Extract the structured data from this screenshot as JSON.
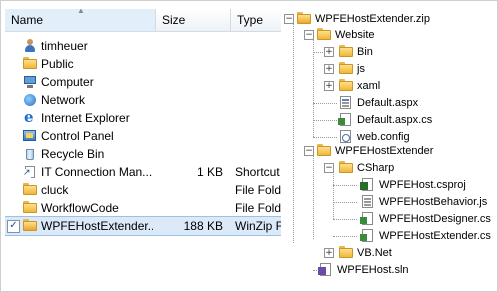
{
  "file_list": {
    "columns": {
      "name": "Name",
      "size": "Size",
      "type": "Type"
    },
    "rows": [
      {
        "name": "timheuer",
        "size": "",
        "type": "",
        "icon": "user-folder-icon",
        "checked": false
      },
      {
        "name": "Public",
        "size": "",
        "type": "",
        "icon": "folder-icon",
        "checked": false
      },
      {
        "name": "Computer",
        "size": "",
        "type": "",
        "icon": "computer-icon",
        "checked": false
      },
      {
        "name": "Network",
        "size": "",
        "type": "",
        "icon": "network-icon",
        "checked": false
      },
      {
        "name": "Internet Explorer",
        "size": "",
        "type": "",
        "icon": "internet-explorer-icon",
        "checked": false
      },
      {
        "name": "Control Panel",
        "size": "",
        "type": "",
        "icon": "control-panel-icon",
        "checked": false
      },
      {
        "name": "Recycle Bin",
        "size": "",
        "type": "",
        "icon": "recycle-bin-icon",
        "checked": false
      },
      {
        "name": "IT Connection Man...",
        "size": "1 KB",
        "type": "Shortcut",
        "icon": "shortcut-icon",
        "checked": false
      },
      {
        "name": "cluck",
        "size": "",
        "type": "File Folder",
        "icon": "folder-icon",
        "checked": false
      },
      {
        "name": "WorkflowCode",
        "size": "",
        "type": "File Folder",
        "icon": "folder-icon",
        "checked": false
      },
      {
        "name": "WPFEHostExtender....",
        "size": "188 KB",
        "type": "WinZip File",
        "icon": "zip-folder-icon",
        "checked": true
      }
    ]
  },
  "tree": {
    "root": "WPFEHostExtender.zip",
    "website": "Website",
    "bin": "Bin",
    "js": "js",
    "xaml": "xaml",
    "default_aspx": "Default.aspx",
    "default_aspx_cs": "Default.aspx.cs",
    "web_config": "web.config",
    "project": "WPFEHostExtender",
    "csharp": "CSharp",
    "csproj": "WPFEHost.csproj",
    "behavior_js": "WPFEHostBehavior.js",
    "designer_cs": "WPFEHostDesigner.cs",
    "extender_cs": "WPFEHostExtender.cs",
    "vbnet": "VB.Net",
    "sln": "WPFEHost.sln"
  }
}
